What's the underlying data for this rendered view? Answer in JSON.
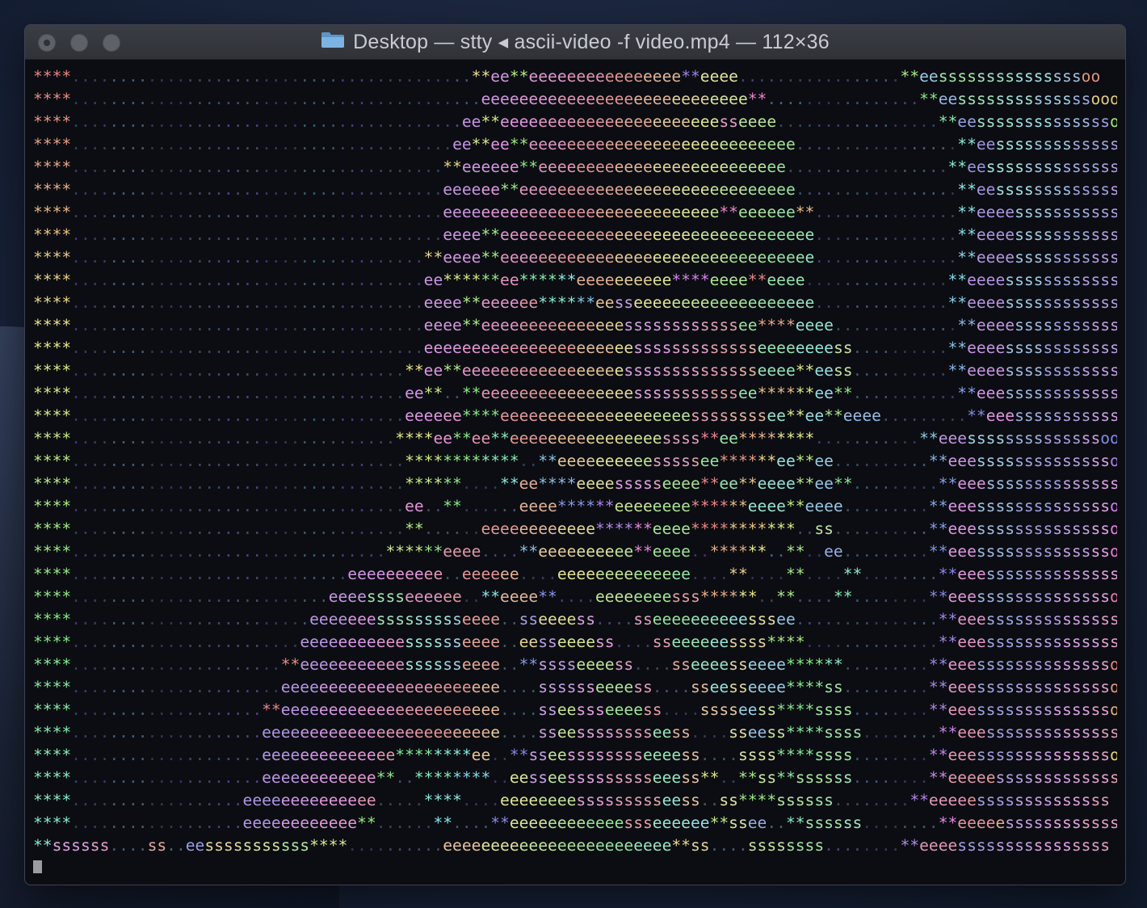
{
  "window": {
    "title": "Desktop — stty ◂ ascii-video -f video.mp4 — 112×36",
    "folder_icon": "folder-icon",
    "buttons": [
      "close",
      "minimize",
      "zoom"
    ]
  },
  "terminal": {
    "columns": 112,
    "rows": 36,
    "lines": [
      "****..........................................**ee**eeeeeeeeeeeeeeee**eeee.................**eesssssssssssssssoo",
      "****...........................................eeeeeeeeeeeeeeeeeeeeeeeeeeee**................**eessssssssssssssoooo",
      "****.........................................ee**eeeeeeeeeeeeeeeeeeeeeeesseeee.................**eessssssssssssssoooo",
      "****........................................ee**ee**eeeeeeeeeeeeeeeeeeeeeeeeeeee.................**eessssssssssssssoooo",
      "****.......................................**eeeeee**eeeeeeeeeeeeeeeeeeeeeeeeee.................**eessssssssssssssoooo",
      "****.......................................eeeeee**eeeeeeeeeeeeeeeeeeeeeeeeeeeee.................**eessssssssssssssoooo",
      "****.......................................eeeeeeeeeeeeeeeeeeeeeeeeeeeee**eeeeee**...............**eeeessssssssssssoooo",
      "****.......................................eeee**eeeeeeeeeeeeeeeeeeeeeeeeeeeeeeeee...............**eeeessssssssssssoooo",
      "****.....................................**eeee**eeeeeeeeeeeeeeeeeeeeeeeeeeeeeeeee...............**eeeessssssssssssoooo",
      "****.....................................ee******ee******eeeeeeeeee****eeee**eeee...............**eeeessssssssssssoooo",
      "****.....................................eeee**eeeeee******eesseeeeeeeeeeeeeeeeeee..............**eeeessssssssssssoooo",
      "****.....................................eeee**eeeeeeeeeeeeeeessssssssssssee****eeee.............**eeeessssssssssssoooo",
      "****.....................................eeeeeeeeeeeeeeeeeeeeeessssssssssssseeeeeeeess..........**eeeessssssssssssoooo",
      "****...................................**ee**eeeeeeeeeeeeeeeeesssssssssssssseeee**eess..........**eeeessssssssssssoooo",
      "****...................................ee**..**eeeeeeeeeeeeeeeesssssssssssee******ee**...........**eeessssssssssssssoo",
      "****...................................eeeeee****eeeeeeeeeeeeeeeeeeeessssssssee**ee**eeee.........**eeessssssssssssssoo",
      "****..................................****ee**ee**eeeeeeeeeeeeeeeessss**ee********...........**eeessssssssssssssoo",
      "****...................................************..**eeeeeeeeeesssssee******ee**ee..........**eeessssssssssssssoo",
      "****...................................******....**ee****eeeessssseeee**ee**eeee**ee**.........**eeessssssssssssssoo",
      "****...................................ee..**......eeee******eeeeeeee******eeee**eeee.........**eeessssssssssssssoo",
      "****...................................**......eeeeeeeeeeee******eeee***********..ss..........**eeessssssssssssssoo",
      "****.................................******eeee....**eeeeeeeeee**eeee..******..**..ee.........**eeessssssssssssssoo",
      "****.............................eeeeeeeeee..eeeeee....eeeeeeeeeeeeee....**....**....**........**eeessssssssssssssoo",
      "****...........................eeeesssseeeeee..**eeee**....eeeeeeeesss******..**....**........**eeessssssssssssssoo",
      "****.........................eeeeeeessssssssseeee..sseeeess....sseeeeeeeeeesssee...............**eeessssssssssssssoo",
      "****........................eeeeeeeeeeesssssseeee..eesseeeess....sseeeeeessss****..............**eeessssssssssssssoo",
      "****......................**eeeeeeeeeeesssssseeee..**sssseeeess....sseeeesseeee******.........**eeessssssssssssssoo",
      "****......................eeeeeeeeeeeeeeeeeeeeeee....sssssseeeess....sseesseeee****ss.........**eeessssssssssssssoo",
      "****....................**eeeeeeeeeeeeeeeeeeeeeee....sseessseeeess....sssseess****ssss........**eeessssssssssssssoo",
      "****....................eeeeeeeeeeeeeeeeeeeeeeeee....sseesssssssseess....sseess****ssss........**eeessssssssssssssoo",
      "****....................eeeeeeeeeeeeee********ee..**sseesssssssseeeess....ssss****ssss........**eeessssssssssssssoo",
      "****....................eeeeeeeeeeee**..********..eesseessssssssseeess**..**ss**ssssss........**eeeeessssssssssssss",
      "****..................eeeeeeeeeeeeee.....****....eeeeeeeessssssssseess..ss****ssssss........**eeeeessssssssssssss",
      "****..................eeeeeeeeeeee**......**....**eeeeeeeeeeeessseeeeee**ssee..**ssssss........**eeeeessssssssssssss",
      "**ssssss....ss..eesssssssssss****..........eeeeeeeeeeeeeeeeeeeeeeee**ss....ssssssss........**eeeessssssssssssssss"
    ]
  }
}
